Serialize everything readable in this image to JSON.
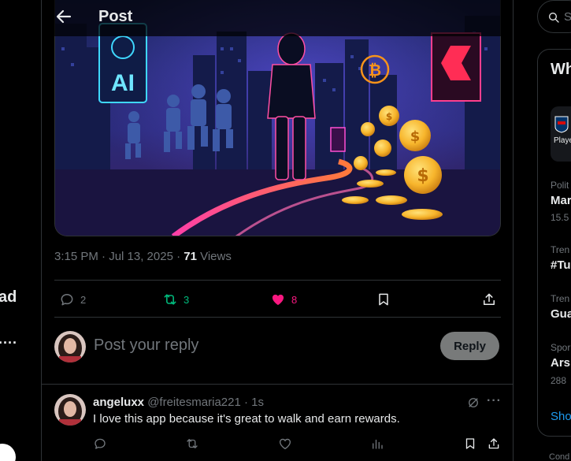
{
  "header": {
    "title": "Post"
  },
  "left_nav": {
    "label_fragment": "ad",
    "more_fragment": "...."
  },
  "post": {
    "timestamp": "3:15 PM · Jul 13, 2025 · ",
    "views_count": "71",
    "views_label": " Views",
    "image": {
      "ai_sign": "AI",
      "crypto_symbol": "₿",
      "coin_symbol": "$"
    },
    "actions": {
      "replies": "2",
      "reposts": "3",
      "likes": "8"
    },
    "colors": {
      "repost": "#00ba7c",
      "like": "#f91880",
      "accent": "#1d9bf0"
    }
  },
  "reply_composer": {
    "placeholder": "Post your reply",
    "button": "Reply"
  },
  "replies": [
    {
      "name": "angeluxx",
      "handle": "@freitesmaria221",
      "time": "1s",
      "text": "I love this app because it's great to walk and earn rewards."
    }
  ],
  "sidebar": {
    "search_placeholder": "S",
    "trends_header": "Wh",
    "card_label": "Playe",
    "trends": [
      {
        "category": "Polit",
        "name": "Mar",
        "count": "15.5"
      },
      {
        "category": "Tren",
        "name": "#Tu",
        "count": ""
      },
      {
        "category": "Tren",
        "name": "Gua",
        "count": ""
      },
      {
        "category": "Spor",
        "name": "Ars",
        "count": "288"
      }
    ],
    "show_more": "Sho",
    "footer_fragment": "Cond"
  }
}
